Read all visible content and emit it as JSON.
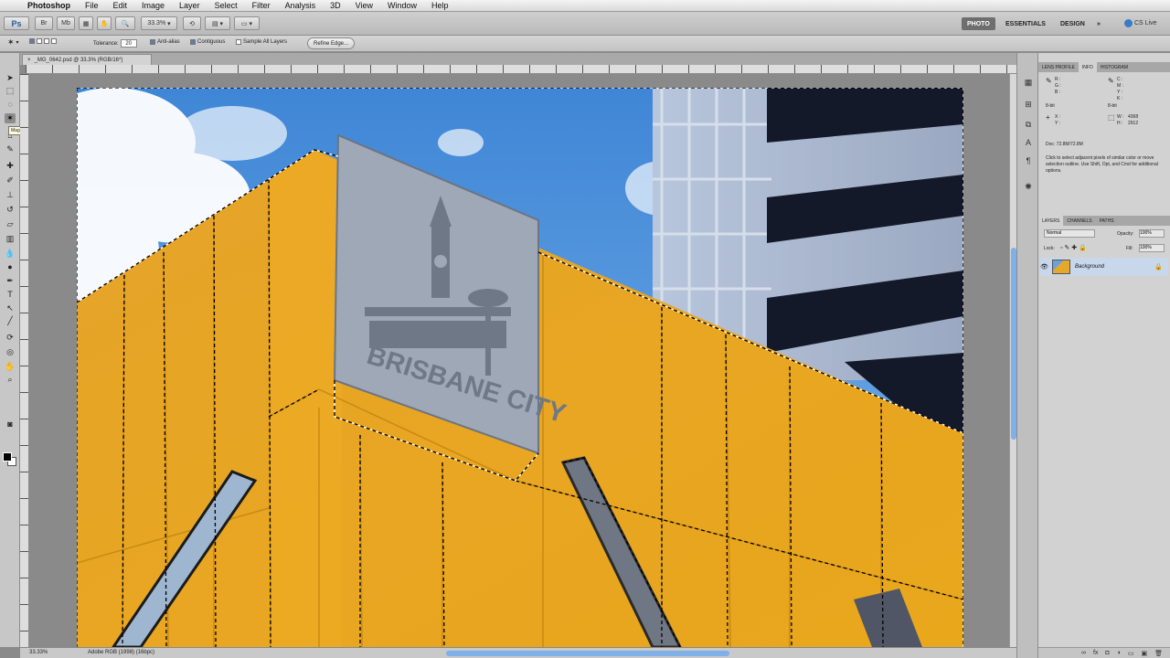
{
  "menubar": {
    "apple_icon": "apple-icon",
    "app_name": "Photoshop",
    "items": [
      "File",
      "Edit",
      "Image",
      "Layer",
      "Select",
      "Filter",
      "Analysis",
      "3D",
      "View",
      "Window",
      "Help"
    ]
  },
  "appbar": {
    "zoom": "33.3%",
    "workspaces": [
      "PHOTO",
      "ESSENTIALS",
      "DESIGN"
    ],
    "more": "»",
    "cs_live": "CS Live"
  },
  "options": {
    "tolerance_label": "Tolerance:",
    "tolerance_value": "20",
    "anti_alias": "Anti-alias",
    "contiguous": "Contiguous",
    "sample_all_layers": "Sample All Layers",
    "refine_edge": "Refine Edge..."
  },
  "document": {
    "tab_title": "_MG_0642.psd @ 33.3% (RGB/16*)",
    "close": "×"
  },
  "tools": {
    "tooltip": "Magic Wand Tool (W)"
  },
  "photo": {
    "sign_text": "BRISBANE CITY"
  },
  "status": {
    "zoom": "33.33%",
    "profile": "Adobe RGB (1998) (16bpc)"
  },
  "info_panel": {
    "tabs": [
      "LENS PROFILE",
      "INFO",
      "HISTOGRAM"
    ],
    "r": "R :",
    "g": "G :",
    "b": "B :",
    "c": "C :",
    "m": "M :",
    "y": "Y :",
    "k": "K :",
    "bit_left": "8-bit",
    "bit_right": "8-bit",
    "x": "X :",
    "y_coord": "Y :",
    "w": "W :",
    "h": "H :",
    "w_value": "4368",
    "h_value": "2912",
    "doc": "Doc: 72.8M/72.8M",
    "hint": "Click to select adjacent pixels of similar color or move selection outline. Use Shift, Opt, and Cmd for additional options."
  },
  "layers_panel": {
    "tabs": [
      "LAYERS",
      "CHANNELS",
      "PATHS"
    ],
    "blend_mode": "Normal",
    "opacity_label": "Opacity:",
    "opacity": "100%",
    "lock_label": "Lock:",
    "fill_label": "Fill:",
    "fill": "100%",
    "layer_name": "Background"
  }
}
